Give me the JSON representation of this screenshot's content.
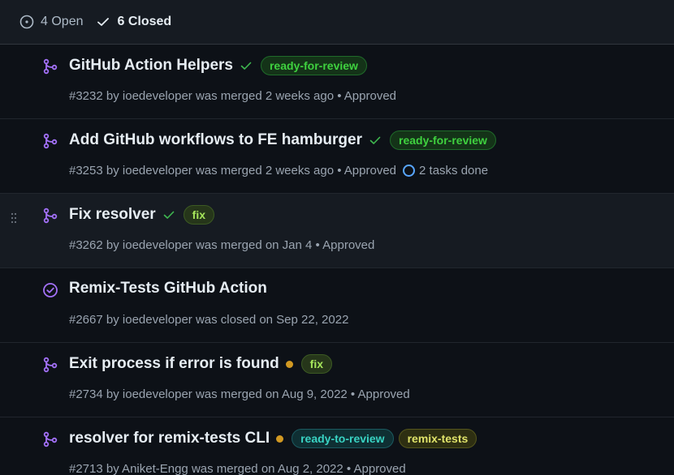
{
  "header": {
    "open_label": "4 Open",
    "closed_label": "6 Closed"
  },
  "colors": {
    "merged": "#a371f7",
    "closed": "#a371f7",
    "success": "#3fb950",
    "pending": "#d29922",
    "link": "#58a6ff"
  },
  "pulls": [
    {
      "title": "GitHub Action Helpers",
      "state": "merged",
      "status": "check",
      "labels": [
        {
          "text": "ready-for-review",
          "color": "#3fd13f",
          "bg": "#143318",
          "border": "#1f6b2a"
        }
      ],
      "meta": "#3232 by ioedeveloper was merged 2 weeks ago • Approved",
      "tasks": ""
    },
    {
      "title": "Add GitHub workflows to FE hamburger",
      "state": "merged",
      "status": "check",
      "labels": [
        {
          "text": "ready-for-review",
          "color": "#3fd13f",
          "bg": "#143318",
          "border": "#1f6b2a"
        }
      ],
      "meta": "#3253 by ioedeveloper was merged 2 weeks ago • Approved",
      "tasks": "2 tasks done"
    },
    {
      "title": "Fix resolver",
      "state": "merged",
      "status": "check",
      "labels": [
        {
          "text": "fix",
          "color": "#a6e65b",
          "bg": "#26361a",
          "border": "#3c5a23"
        }
      ],
      "meta": "#3262 by ioedeveloper was merged on Jan 4 • Approved",
      "tasks": ""
    },
    {
      "title": "Remix-Tests GitHub Action",
      "state": "closed",
      "status": "",
      "labels": [],
      "meta": "#2667 by ioedeveloper was closed on Sep 22, 2022",
      "tasks": ""
    },
    {
      "title": "Exit process if error is found",
      "state": "merged",
      "status": "dot",
      "labels": [
        {
          "text": "fix",
          "color": "#a6e65b",
          "bg": "#26361a",
          "border": "#3c5a23"
        }
      ],
      "meta": "#2734 by ioedeveloper was merged on Aug 9, 2022 • Approved",
      "tasks": ""
    },
    {
      "title": "resolver for remix-tests CLI",
      "state": "merged",
      "status": "dot",
      "labels": [
        {
          "text": "ready-to-review",
          "color": "#39d3c3",
          "bg": "#0f2f33",
          "border": "#1b5a60"
        },
        {
          "text": "remix-tests",
          "color": "#e0e36a",
          "bg": "#2e2f12",
          "border": "#55561c"
        }
      ],
      "meta": "#2713 by Aniket-Engg was merged on Aug 2, 2022 • Approved",
      "tasks": ""
    }
  ]
}
